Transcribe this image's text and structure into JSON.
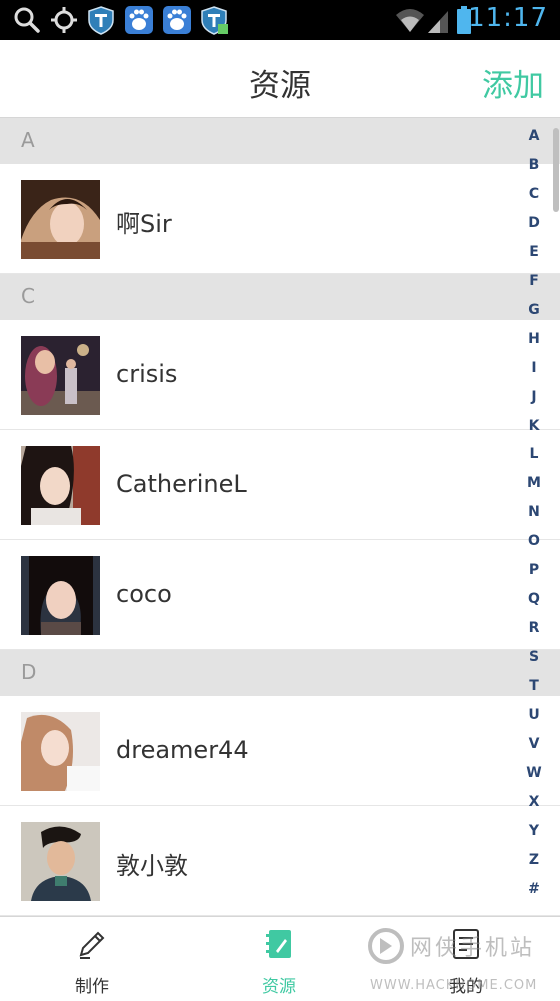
{
  "status_bar": {
    "time": "11:17",
    "icons": [
      "search-icon",
      "location-icon",
      "shield-icon",
      "baidu-icon",
      "baidu-icon",
      "shield-icon",
      "wifi-icon",
      "signal-icon",
      "battery-icon"
    ]
  },
  "header": {
    "title": "资源",
    "add_label": "添加"
  },
  "sections": [
    {
      "letter": "A",
      "contacts": [
        {
          "name": "啊Sir"
        }
      ]
    },
    {
      "letter": "C",
      "contacts": [
        {
          "name": "crisis"
        },
        {
          "name": "CatherineL"
        },
        {
          "name": "coco"
        }
      ]
    },
    {
      "letter": "D",
      "contacts": [
        {
          "name": "dreamer44"
        },
        {
          "name": "敦小敦"
        }
      ]
    }
  ],
  "index_letters": [
    "A",
    "B",
    "C",
    "D",
    "E",
    "F",
    "G",
    "H",
    "I",
    "J",
    "K",
    "L",
    "M",
    "N",
    "O",
    "P",
    "Q",
    "R",
    "S",
    "T",
    "U",
    "V",
    "W",
    "X",
    "Y",
    "Z",
    "#"
  ],
  "bottom_nav": [
    {
      "label": "制作",
      "icon": "pencil-icon",
      "active": false
    },
    {
      "label": "资源",
      "icon": "notebook-icon",
      "active": true
    },
    {
      "label": "我的",
      "icon": "profile-icon",
      "active": false
    }
  ],
  "watermark": {
    "text": "网侠手机站",
    "url": "WWW.HACKHOME.COM"
  },
  "colors": {
    "accent": "#40c9a2",
    "index_letter": "#2c4773",
    "section_bg": "#e3e3e3",
    "status_time": "#4fb6ee"
  }
}
